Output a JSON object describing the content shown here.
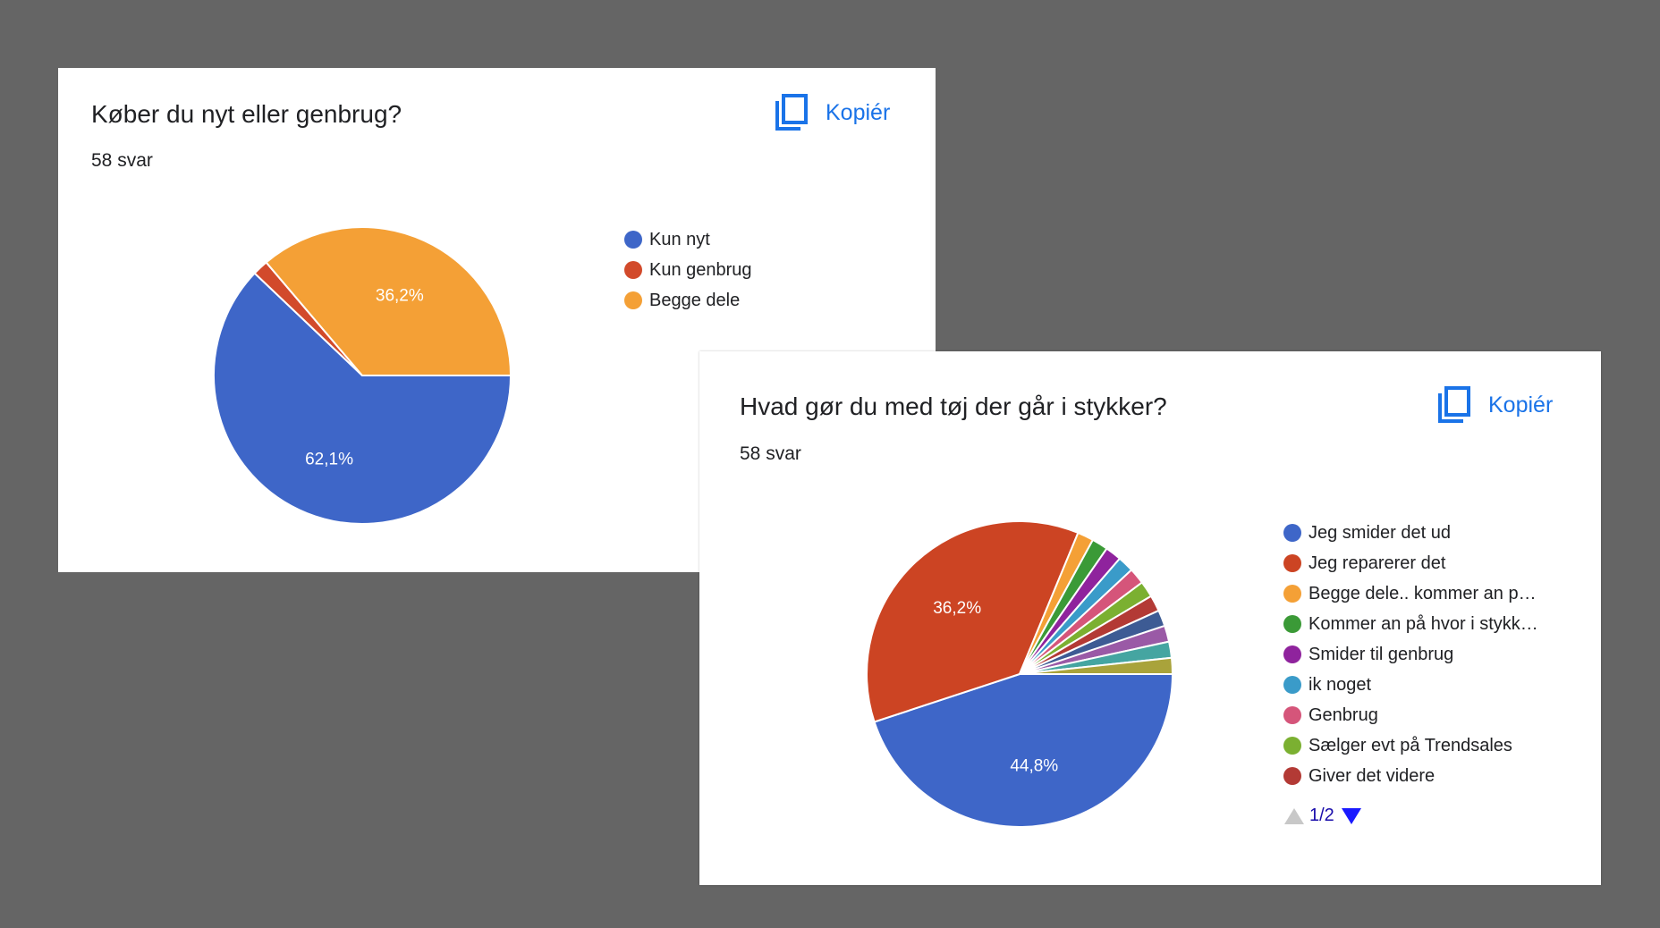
{
  "colors": {
    "background": "#656565",
    "card": "#ffffff",
    "accent": "#1a73e8"
  },
  "cards": [
    {
      "title": "Køber du nyt eller genbrug?",
      "count": "58 svar",
      "copy_label": "Kopiér",
      "copy_icon": "copy-icon"
    },
    {
      "title": "Hvad gør du med tøj der går i stykker?",
      "count": "58 svar",
      "copy_label": "Kopiér",
      "copy_icon": "copy-icon",
      "pager": {
        "text": "1/2",
        "prev_icon": "triangle-up-icon",
        "next_icon": "triangle-down-icon"
      }
    }
  ],
  "chart_data": [
    {
      "type": "pie",
      "title": "Køber du nyt eller genbrug?",
      "legend_position": "right",
      "start_angle_deg": 90,
      "direction": "clockwise",
      "series": [
        {
          "name": "Kun nyt",
          "value": 62.1,
          "label": "62,1%",
          "color": "#3e66c8"
        },
        {
          "name": "Kun genbrug",
          "value": 1.7,
          "label": "",
          "color": "#d24a2b"
        },
        {
          "name": "Begge dele",
          "value": 36.2,
          "label": "36,2%",
          "color": "#f4a036"
        }
      ]
    },
    {
      "type": "pie",
      "title": "Hvad gør du med tøj der går i stykker?",
      "legend_position": "right",
      "start_angle_deg": 90,
      "direction": "clockwise",
      "series": [
        {
          "name": "Jeg smider det ud",
          "value": 44.8,
          "label": "44,8%",
          "color": "#3e66c8",
          "legend": "Jeg smider det ud"
        },
        {
          "name": "Jeg reparerer det",
          "value": 36.2,
          "label": "36,2%",
          "color": "#cc4423",
          "legend": "Jeg reparerer det"
        },
        {
          "name": "Begge dele.. kommer an p…",
          "value": 1.7,
          "label": "",
          "color": "#f4a036",
          "legend": "Begge dele.. kommer an p…"
        },
        {
          "name": "Kommer an på hvor i stykk…",
          "value": 1.7,
          "label": "",
          "color": "#3b9a37",
          "legend": "Kommer an på hvor i stykk…"
        },
        {
          "name": "Smider til genbrug",
          "value": 1.7,
          "label": "",
          "color": "#8f239d",
          "legend": "Smider til genbrug"
        },
        {
          "name": "ik noget",
          "value": 1.7,
          "label": "",
          "color": "#3a9bc9",
          "legend": "ik noget"
        },
        {
          "name": "Genbrug",
          "value": 1.7,
          "label": "",
          "color": "#d5557a",
          "legend": "Genbrug"
        },
        {
          "name": "Sælger evt på Trendsales",
          "value": 1.7,
          "label": "",
          "color": "#7bb031",
          "legend": "Sælger evt på Trendsales"
        },
        {
          "name": "Giver det videre",
          "value": 1.7,
          "label": "",
          "color": "#b33a35",
          "legend": "Giver det videre"
        },
        {
          "name": "",
          "value": 1.7,
          "label": "",
          "color": "#3d5b94"
        },
        {
          "name": "",
          "value": 1.7,
          "label": "",
          "color": "#9a5aa6"
        },
        {
          "name": "",
          "value": 1.7,
          "label": "",
          "color": "#45a5a1"
        },
        {
          "name": "",
          "value": 1.7,
          "label": "",
          "color": "#a9a33b"
        }
      ]
    }
  ]
}
